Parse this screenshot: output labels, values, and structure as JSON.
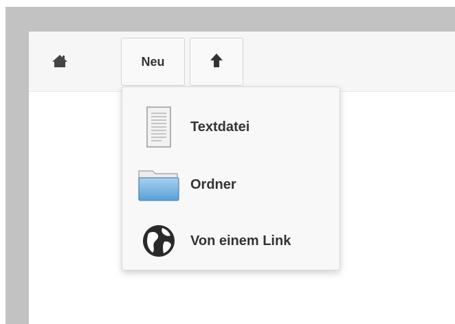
{
  "toolbar": {
    "home_icon": "home-icon",
    "new_label": "Neu",
    "up_icon": "arrow-up-icon"
  },
  "dropdown": {
    "items": [
      {
        "label": "Textdatei",
        "icon": "text-file-icon"
      },
      {
        "label": "Ordner",
        "icon": "folder-icon"
      },
      {
        "label": "Von einem Link",
        "icon": "globe-icon"
      }
    ]
  }
}
